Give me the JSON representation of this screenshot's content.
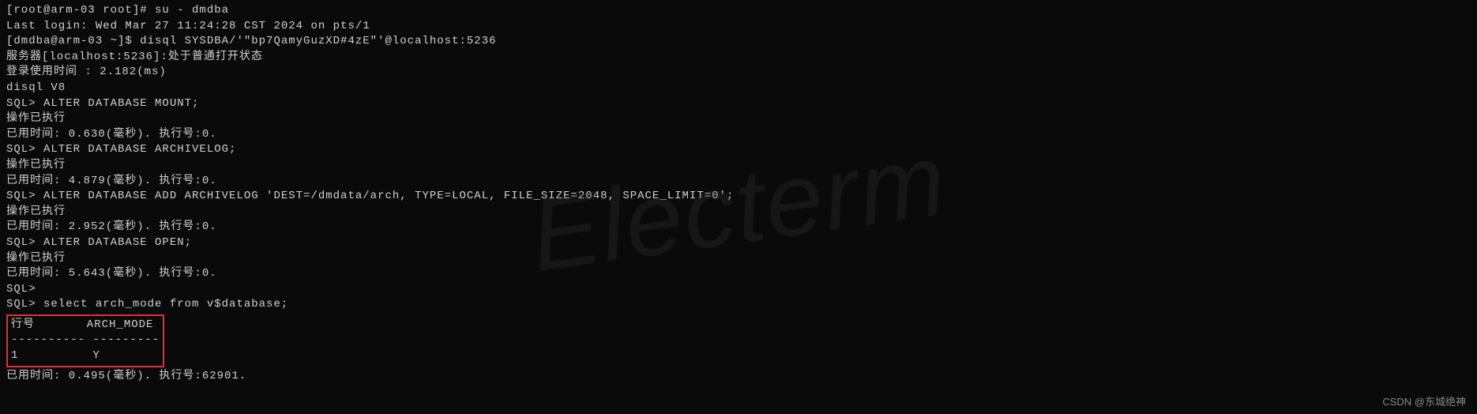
{
  "terminal": {
    "lines": {
      "l1": "[root@arm-03 root]# su - dmdba",
      "l2": "Last login: Wed Mar 27 11:24:28 CST 2024 on pts/1",
      "l3": "[dmdba@arm-03 ~]$ disql SYSDBA/'\"bp7QamyGuzXD#4zE\"'@localhost:5236",
      "l4": "",
      "l5": "服务器[localhost:5236]:处于普通打开状态",
      "l6": "登录使用时间 : 2.182(ms)",
      "l7": "disql V8",
      "l8": "SQL> ALTER DATABASE MOUNT;",
      "l9": "操作已执行",
      "l10": "已用时间: 0.630(毫秒). 执行号:0.",
      "l11": "SQL> ALTER DATABASE ARCHIVELOG;",
      "l12": "操作已执行",
      "l13": "已用时间: 4.879(毫秒). 执行号:0.",
      "l14": "SQL> ALTER DATABASE ADD ARCHIVELOG 'DEST=/dmdata/arch, TYPE=LOCAL, FILE_SIZE=2048, SPACE_LIMIT=0';",
      "l15": "操作已执行",
      "l16": "已用时间: 2.952(毫秒). 执行号:0.",
      "l17": "SQL> ALTER DATABASE OPEN;",
      "l18": "操作已执行",
      "l19": "已用时间: 5.643(毫秒). 执行号:0.",
      "l20": "SQL>",
      "l21": "SQL> select arch_mode from v$database;",
      "l22": "",
      "box1": "行号       ARCH_MODE",
      "box2": "---------- ---------",
      "box3": "1          Y",
      "l23": "",
      "l24": "已用时间: 0.495(毫秒). 执行号:62901."
    }
  },
  "watermark": "Electerm",
  "attribution": "CSDN @东城绝神"
}
